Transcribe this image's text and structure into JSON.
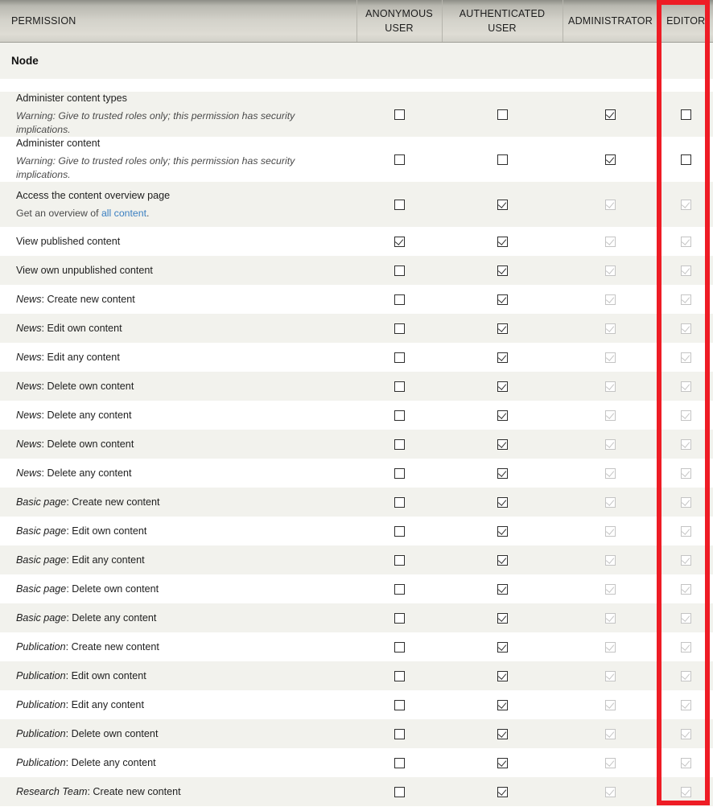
{
  "table": {
    "columns": [
      {
        "id": "permission",
        "label": "PERMISSION"
      },
      {
        "id": "anonymous_user",
        "label": "ANONYMOUS USER"
      },
      {
        "id": "authenticated_user",
        "label": "AUTHENTICATED USER"
      },
      {
        "id": "administrator",
        "label": "ADMINISTRATOR"
      },
      {
        "id": "editor",
        "label": "EDITOR"
      }
    ],
    "section_label": "Node",
    "rows": [
      {
        "title": "Administer content types",
        "prefix": "",
        "description": "Warning: Give to trusted roles only; this permission has security implications.",
        "description_style": "warning",
        "anonymous_user": "unchecked",
        "authenticated_user": "unchecked",
        "administrator": "checked",
        "editor": "unchecked"
      },
      {
        "title": "Administer content",
        "prefix": "",
        "description": "Warning: Give to trusted roles only; this permission has security implications.",
        "description_style": "warning",
        "anonymous_user": "unchecked",
        "authenticated_user": "unchecked",
        "administrator": "checked",
        "editor": "unchecked"
      },
      {
        "title": "Access the content overview page",
        "prefix": "",
        "description": "Get an overview of all content.",
        "description_style": "link",
        "description_link_text": "all content",
        "anonymous_user": "unchecked",
        "authenticated_user": "checked",
        "administrator": "checked-disabled",
        "editor": "checked-disabled"
      },
      {
        "title": "View published content",
        "prefix": "",
        "description": "",
        "anonymous_user": "checked",
        "authenticated_user": "checked",
        "administrator": "checked-disabled",
        "editor": "checked-disabled"
      },
      {
        "title": "View own unpublished content",
        "prefix": "",
        "description": "",
        "anonymous_user": "unchecked",
        "authenticated_user": "checked",
        "administrator": "checked-disabled",
        "editor": "checked-disabled"
      },
      {
        "title": "Create new content",
        "prefix": "News",
        "description": "",
        "anonymous_user": "unchecked",
        "authenticated_user": "checked",
        "administrator": "checked-disabled",
        "editor": "checked-disabled"
      },
      {
        "title": "Edit own content",
        "prefix": "News",
        "description": "",
        "anonymous_user": "unchecked",
        "authenticated_user": "checked",
        "administrator": "checked-disabled",
        "editor": "checked-disabled"
      },
      {
        "title": "Edit any content",
        "prefix": "News",
        "description": "",
        "anonymous_user": "unchecked",
        "authenticated_user": "checked",
        "administrator": "checked-disabled",
        "editor": "checked-disabled"
      },
      {
        "title": "Delete own content",
        "prefix": "News",
        "description": "",
        "anonymous_user": "unchecked",
        "authenticated_user": "checked",
        "administrator": "checked-disabled",
        "editor": "checked-disabled"
      },
      {
        "title": "Delete any content",
        "prefix": "News",
        "description": "",
        "anonymous_user": "unchecked",
        "authenticated_user": "checked",
        "administrator": "checked-disabled",
        "editor": "checked-disabled"
      },
      {
        "title": "Delete own content",
        "prefix": "News",
        "description": "",
        "anonymous_user": "unchecked",
        "authenticated_user": "checked",
        "administrator": "checked-disabled",
        "editor": "checked-disabled"
      },
      {
        "title": "Delete any content",
        "prefix": "News",
        "description": "",
        "anonymous_user": "unchecked",
        "authenticated_user": "checked",
        "administrator": "checked-disabled",
        "editor": "checked-disabled"
      },
      {
        "title": "Create new content",
        "prefix": "Basic page",
        "description": "",
        "anonymous_user": "unchecked",
        "authenticated_user": "checked",
        "administrator": "checked-disabled",
        "editor": "checked-disabled"
      },
      {
        "title": "Edit own content",
        "prefix": "Basic page",
        "description": "",
        "anonymous_user": "unchecked",
        "authenticated_user": "checked",
        "administrator": "checked-disabled",
        "editor": "checked-disabled"
      },
      {
        "title": "Edit any content",
        "prefix": "Basic page",
        "description": "",
        "anonymous_user": "unchecked",
        "authenticated_user": "checked",
        "administrator": "checked-disabled",
        "editor": "checked-disabled"
      },
      {
        "title": "Delete own content",
        "prefix": "Basic page",
        "description": "",
        "anonymous_user": "unchecked",
        "authenticated_user": "checked",
        "administrator": "checked-disabled",
        "editor": "checked-disabled"
      },
      {
        "title": "Delete any content",
        "prefix": "Basic page",
        "description": "",
        "anonymous_user": "unchecked",
        "authenticated_user": "checked",
        "administrator": "checked-disabled",
        "editor": "checked-disabled"
      },
      {
        "title": "Create new content",
        "prefix": "Publication",
        "description": "",
        "anonymous_user": "unchecked",
        "authenticated_user": "checked",
        "administrator": "checked-disabled",
        "editor": "checked-disabled"
      },
      {
        "title": "Edit own content",
        "prefix": "Publication",
        "description": "",
        "anonymous_user": "unchecked",
        "authenticated_user": "checked",
        "administrator": "checked-disabled",
        "editor": "checked-disabled"
      },
      {
        "title": "Edit any content",
        "prefix": "Publication",
        "description": "",
        "anonymous_user": "unchecked",
        "authenticated_user": "checked",
        "administrator": "checked-disabled",
        "editor": "checked-disabled"
      },
      {
        "title": "Delete own content",
        "prefix": "Publication",
        "description": "",
        "anonymous_user": "unchecked",
        "authenticated_user": "checked",
        "administrator": "checked-disabled",
        "editor": "checked-disabled"
      },
      {
        "title": "Delete any content",
        "prefix": "Publication",
        "description": "",
        "anonymous_user": "unchecked",
        "authenticated_user": "checked",
        "administrator": "checked-disabled",
        "editor": "checked-disabled"
      },
      {
        "title": "Create new content",
        "prefix": "Research Team",
        "description": "",
        "anonymous_user": "unchecked",
        "authenticated_user": "checked",
        "administrator": "checked-disabled",
        "editor": "checked-disabled"
      }
    ]
  },
  "annotation": {
    "highlighted_column": "EDITOR",
    "color": "#ee1c25"
  }
}
